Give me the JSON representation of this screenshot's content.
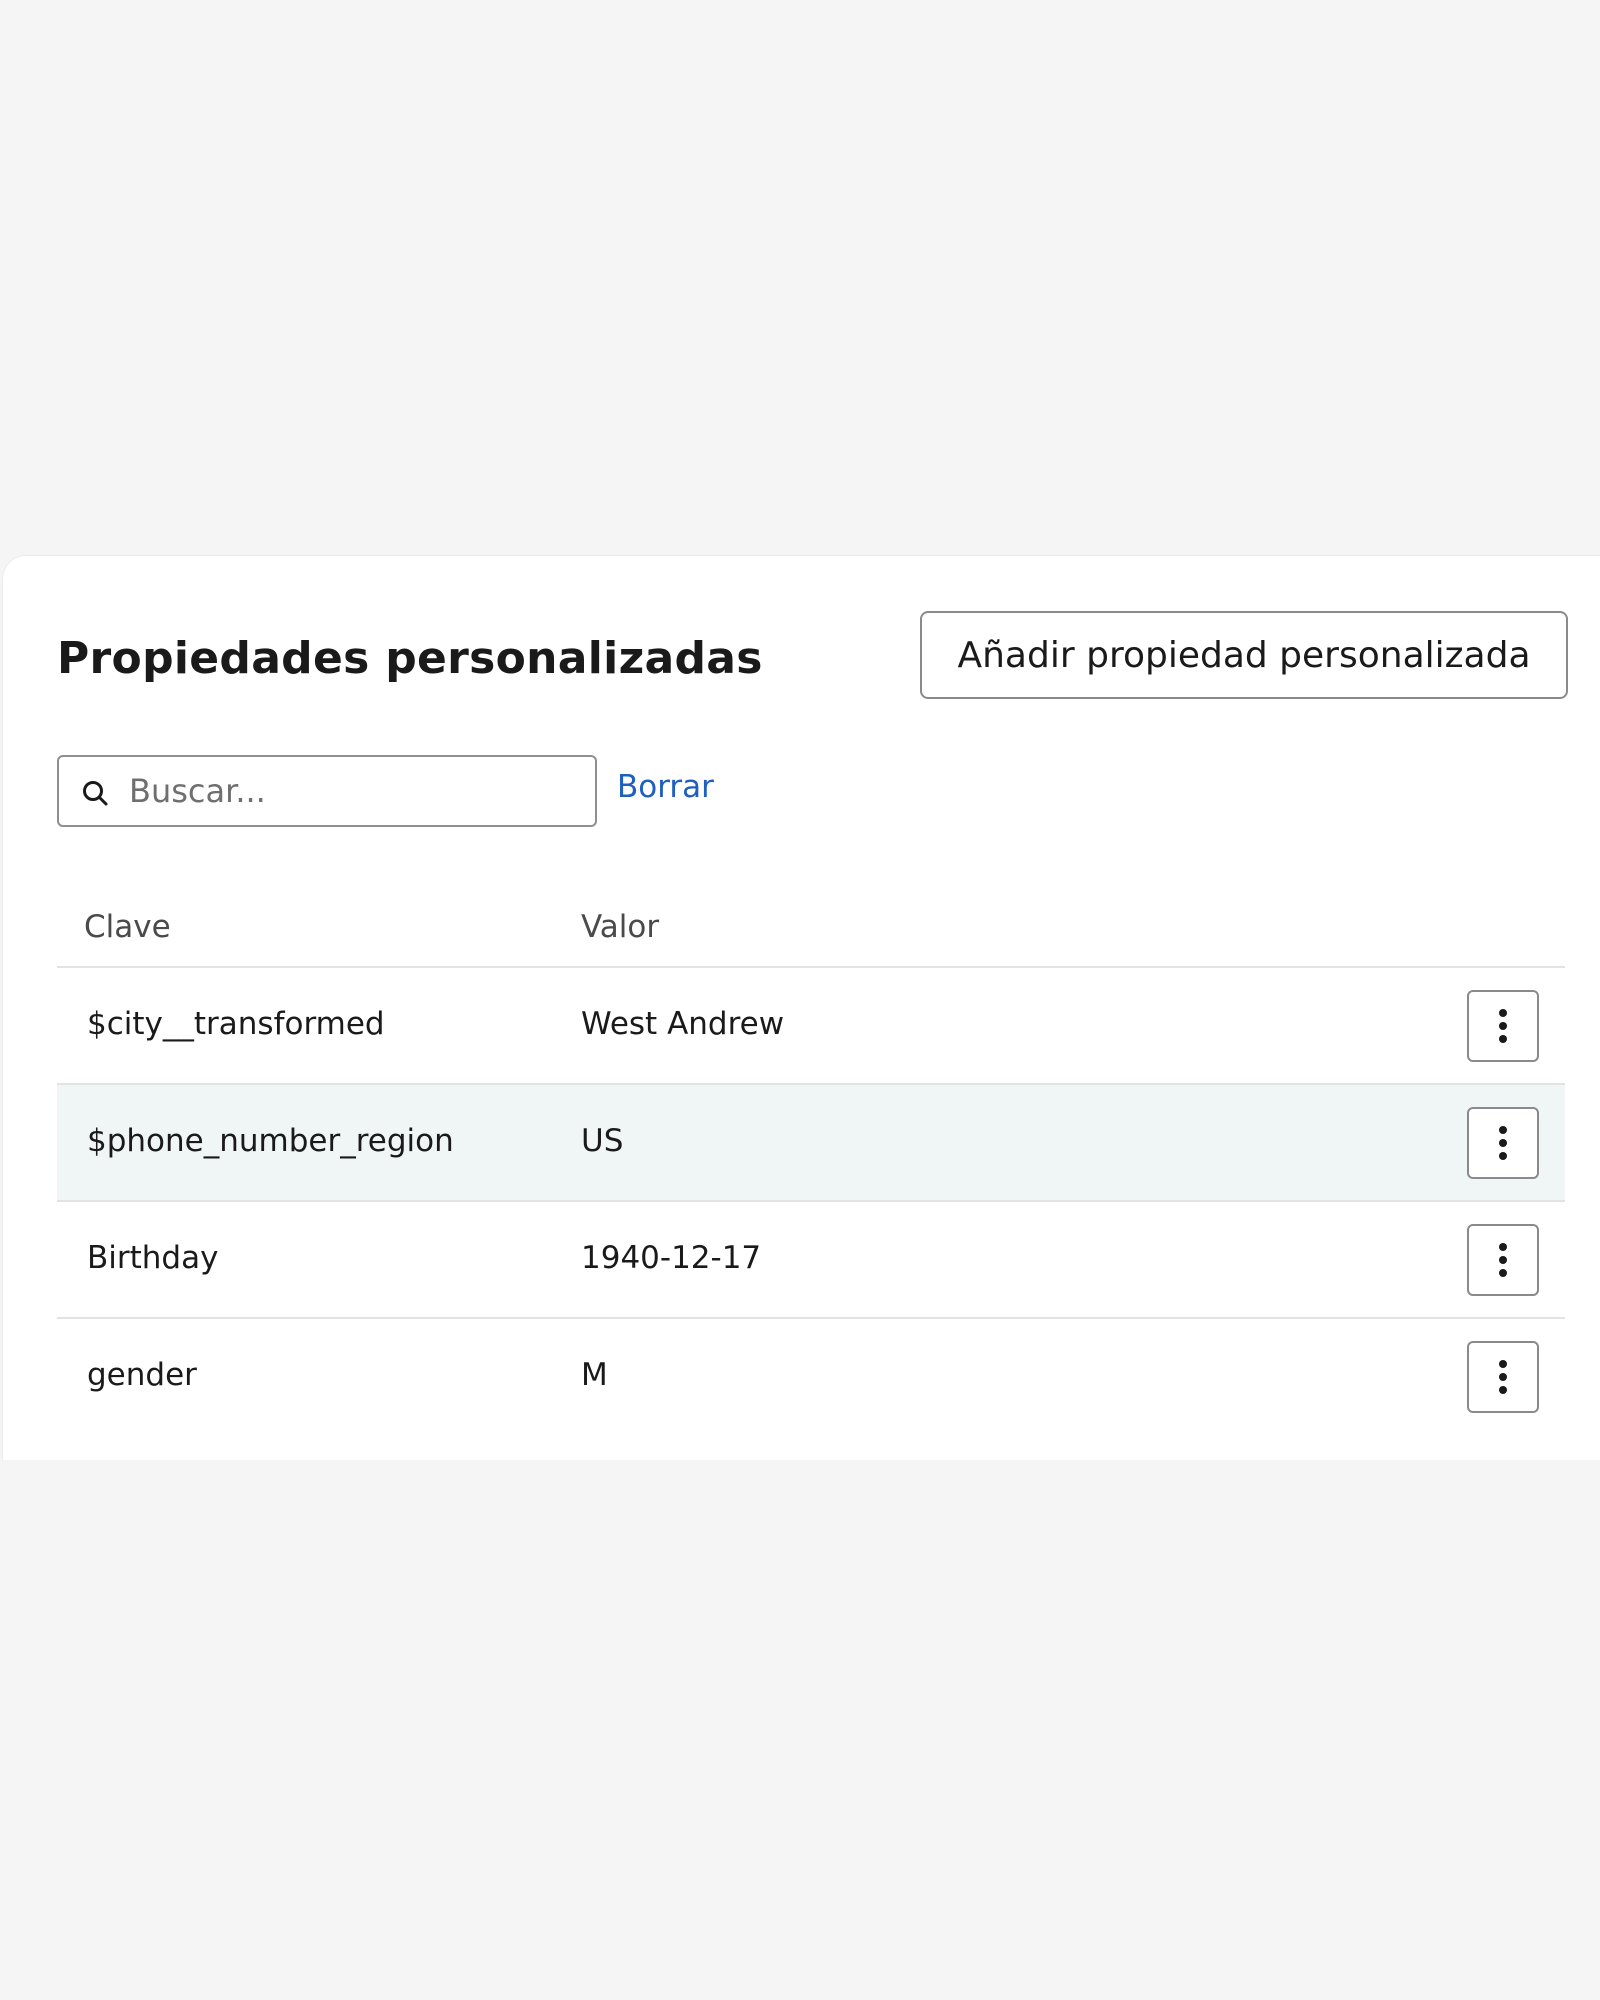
{
  "section": {
    "title": "Propiedades personalizadas",
    "add_button_label": "Añadir propiedad personalizada"
  },
  "search": {
    "placeholder": "Buscar...",
    "value": "",
    "clear_label": "Borrar",
    "icon": "search-icon"
  },
  "table": {
    "columns": [
      "Clave",
      "Valor"
    ],
    "rows": [
      {
        "key": "$city__transformed",
        "value": "West Andrew",
        "highlighted": false
      },
      {
        "key": "$phone_number_region",
        "value": "US",
        "highlighted": true
      },
      {
        "key": "Birthday",
        "value": "1940-12-17",
        "highlighted": false
      },
      {
        "key": "gender",
        "value": "M",
        "highlighted": false
      }
    ],
    "row_action_icon": "more-vertical-icon"
  },
  "colors": {
    "page_background": "#f5f5f5",
    "card_background": "#ffffff",
    "link": "#1f5fbf",
    "row_highlight": "#f0f6f6"
  }
}
